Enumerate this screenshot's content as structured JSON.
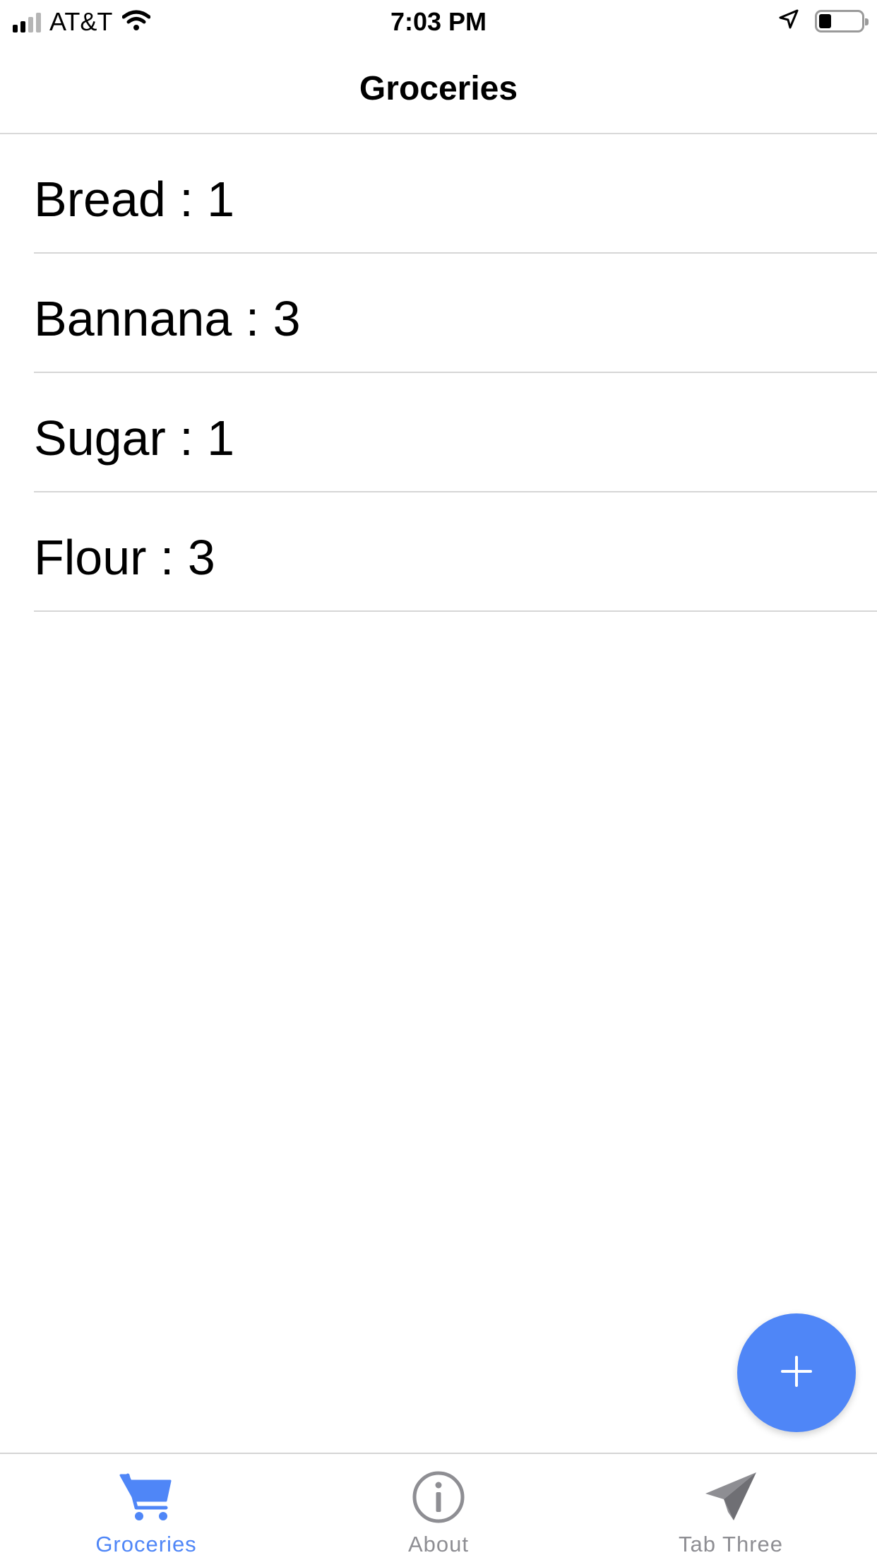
{
  "status_bar": {
    "carrier": "AT&T",
    "time": "7:03 PM",
    "signal_bars_active": 2,
    "signal_bars_total": 4,
    "battery_level": 0.3,
    "icons": [
      "signal-icon",
      "wifi-icon",
      "location-arrow-icon",
      "battery-icon"
    ]
  },
  "nav": {
    "title": "Groceries"
  },
  "list": {
    "items": [
      {
        "label": "Bread : 1"
      },
      {
        "label": "Bannana : 3"
      },
      {
        "label": "Sugar : 1"
      },
      {
        "label": "Flour : 3"
      }
    ]
  },
  "fab": {
    "icon": "plus-icon"
  },
  "tabs": [
    {
      "label": "Groceries",
      "icon": "cart-icon",
      "active": true
    },
    {
      "label": "About",
      "icon": "info-icon",
      "active": false
    },
    {
      "label": "Tab Three",
      "icon": "send-icon",
      "active": false
    }
  ],
  "colors": {
    "accent": "#4f86f7",
    "inactive_tab": "#8e8e93",
    "separator": "#d6d6d6",
    "fab_icon": "#ffffff"
  }
}
